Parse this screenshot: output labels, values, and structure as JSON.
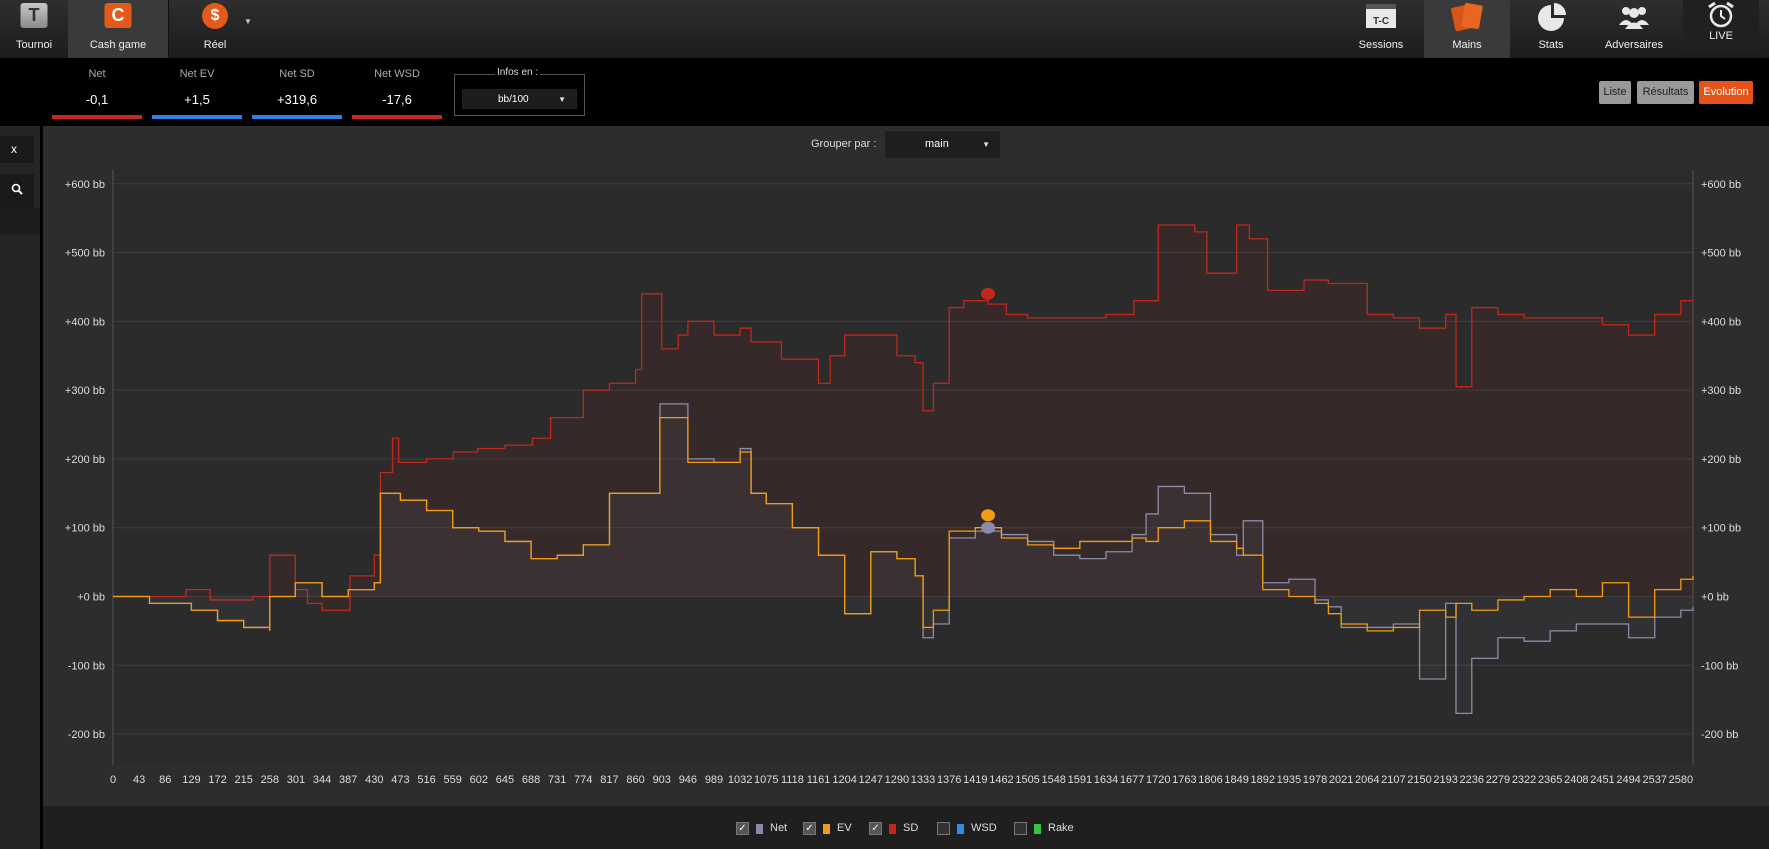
{
  "nav": {
    "left": [
      {
        "label": "Tournoi",
        "tile": "T"
      },
      {
        "label": "Cash game",
        "tile": "C"
      },
      {
        "label": "Réel",
        "tile": "$"
      }
    ],
    "right": [
      {
        "label": "Sessions",
        "tile": "T-C"
      },
      {
        "label": "Mains"
      },
      {
        "label": "Stats"
      },
      {
        "label": "Adversaires"
      },
      {
        "label": "LIVE"
      }
    ],
    "active_left": "Cash game",
    "active_right": "Mains"
  },
  "stats": [
    {
      "label": "Net",
      "value": "-0,1",
      "color": "#c8281e"
    },
    {
      "label": "Net EV",
      "value": "+1,5",
      "color": "#2f7fe6"
    },
    {
      "label": "Net SD",
      "value": "+319,6",
      "color": "#2f7fe6"
    },
    {
      "label": "Net WSD",
      "value": "-17,6",
      "color": "#c8281e"
    }
  ],
  "infos": {
    "title": "Infos en :",
    "selected": "bb/100"
  },
  "view_buttons": [
    {
      "label": "Liste",
      "active": false
    },
    {
      "label": "Résultats",
      "active": false
    },
    {
      "label": "Evolution",
      "active": true
    }
  ],
  "sidebar": {
    "close_label": "x",
    "zoom_icon": "magnifier-icon"
  },
  "group": {
    "label": "Grouper par :",
    "selected": "main"
  },
  "legend": [
    {
      "label": "Net",
      "checked": true,
      "color": "#8888aa"
    },
    {
      "label": "EV",
      "checked": true,
      "color": "#f39c12"
    },
    {
      "label": "SD",
      "checked": true,
      "color": "#c0281c"
    },
    {
      "label": "WSD",
      "checked": false,
      "color": "#2f8ae8"
    },
    {
      "label": "Rake",
      "checked": false,
      "color": "#35c43d"
    }
  ],
  "chart_data": {
    "type": "line",
    "x_ticks": [
      0,
      43,
      86,
      129,
      172,
      215,
      258,
      301,
      344,
      387,
      430,
      473,
      516,
      559,
      602,
      645,
      688,
      731,
      774,
      817,
      860,
      903,
      946,
      989,
      1032,
      1075,
      1118,
      1161,
      1204,
      1247,
      1290,
      1333,
      1376,
      1419,
      1462,
      1505,
      1548,
      1591,
      1634,
      1677,
      1720,
      1763,
      1806,
      1849,
      1892,
      1935,
      1978,
      2021,
      2064,
      2107,
      2150,
      2193,
      2236,
      2279,
      2322,
      2365,
      2408,
      2451,
      2494,
      2537,
      2580
    ],
    "y_tick_labels": [
      "+600 bb",
      "+500 bb",
      "+400 bb",
      "+300 bb",
      "+200 bb",
      "+100 bb",
      "+0 bb",
      "-100 bb",
      "-200 bb"
    ],
    "y_ticks": [
      600,
      500,
      400,
      300,
      200,
      100,
      0,
      -100,
      -200
    ],
    "xlim": [
      0,
      2600
    ],
    "ylim": [
      -245,
      620
    ],
    "grid": true,
    "series": [
      {
        "name": "SD",
        "color": "#c0281c",
        "fill": true,
        "x": [
          0,
          120,
          160,
          230,
          258,
          258,
          300,
          320,
          344,
          390,
          430,
          440,
          460,
          470,
          516,
          560,
          600,
          645,
          690,
          720,
          774,
          817,
          860,
          870,
          903,
          930,
          946,
          989,
          1032,
          1050,
          1100,
          1161,
          1180,
          1204,
          1250,
          1290,
          1320,
          1333,
          1350,
          1376,
          1400,
          1440,
          1470,
          1505,
          1560,
          1634,
          1680,
          1720,
          1780,
          1800,
          1849,
          1870,
          1900,
          1960,
          2000,
          2064,
          2107,
          2150,
          2193,
          2210,
          2236,
          2279,
          2322,
          2400,
          2451,
          2494,
          2537,
          2580,
          2600
        ],
        "y": [
          0,
          10,
          -5,
          0,
          35,
          60,
          10,
          -10,
          -20,
          30,
          60,
          180,
          230,
          195,
          200,
          210,
          215,
          220,
          230,
          260,
          300,
          310,
          330,
          440,
          360,
          380,
          400,
          380,
          390,
          370,
          345,
          310,
          350,
          380,
          380,
          350,
          340,
          270,
          310,
          420,
          430,
          425,
          410,
          405,
          405,
          410,
          430,
          540,
          530,
          470,
          540,
          520,
          445,
          460,
          455,
          410,
          405,
          390,
          410,
          305,
          420,
          410,
          405,
          405,
          395,
          380,
          410,
          430,
          430
        ]
      },
      {
        "name": "Net",
        "color": "#8c8ca8",
        "fill": true,
        "x": [
          0,
          60,
          129,
          172,
          215,
          258,
          258,
          300,
          344,
          387,
          430,
          440,
          473,
          516,
          559,
          602,
          645,
          688,
          731,
          774,
          817,
          860,
          875,
          900,
          946,
          989,
          1032,
          1050,
          1075,
          1118,
          1161,
          1204,
          1247,
          1290,
          1320,
          1333,
          1350,
          1376,
          1419,
          1462,
          1505,
          1548,
          1591,
          1634,
          1677,
          1700,
          1720,
          1763,
          1806,
          1849,
          1860,
          1892,
          1935,
          1978,
          2000,
          2021,
          2064,
          2107,
          2150,
          2193,
          2210,
          2236,
          2279,
          2322,
          2365,
          2408,
          2451,
          2494,
          2537,
          2580,
          2600
        ],
        "y": [
          0,
          -10,
          -20,
          -35,
          -45,
          -50,
          0,
          20,
          0,
          10,
          20,
          150,
          140,
          125,
          100,
          95,
          80,
          55,
          60,
          75,
          150,
          150,
          150,
          280,
          200,
          195,
          215,
          150,
          135,
          100,
          60,
          -25,
          65,
          55,
          30,
          -60,
          -40,
          85,
          95,
          90,
          80,
          60,
          55,
          65,
          90,
          120,
          160,
          150,
          90,
          60,
          110,
          20,
          25,
          -5,
          -15,
          -45,
          -45,
          -40,
          -120,
          -10,
          -170,
          -90,
          -60,
          -65,
          -50,
          -40,
          -40,
          -60,
          -30,
          -20,
          -15
        ]
      },
      {
        "name": "EV",
        "color": "#f39c12",
        "fill": false,
        "x": [
          0,
          60,
          129,
          172,
          215,
          258,
          258,
          300,
          344,
          387,
          430,
          440,
          473,
          516,
          559,
          602,
          645,
          688,
          731,
          774,
          817,
          860,
          875,
          900,
          946,
          989,
          1032,
          1050,
          1075,
          1118,
          1161,
          1204,
          1247,
          1290,
          1320,
          1333,
          1350,
          1376,
          1419,
          1462,
          1505,
          1548,
          1591,
          1634,
          1677,
          1700,
          1720,
          1763,
          1806,
          1849,
          1860,
          1892,
          1935,
          1978,
          2000,
          2021,
          2064,
          2107,
          2150,
          2193,
          2210,
          2236,
          2279,
          2322,
          2365,
          2408,
          2451,
          2494,
          2537,
          2580,
          2600
        ],
        "y": [
          0,
          -10,
          -20,
          -35,
          -45,
          -50,
          0,
          20,
          0,
          10,
          20,
          150,
          140,
          125,
          100,
          95,
          80,
          55,
          60,
          75,
          150,
          150,
          150,
          260,
          195,
          195,
          210,
          150,
          135,
          100,
          60,
          -25,
          65,
          55,
          30,
          -45,
          -20,
          95,
          100,
          85,
          75,
          70,
          80,
          80,
          85,
          80,
          100,
          110,
          80,
          70,
          60,
          10,
          0,
          -10,
          -25,
          -40,
          -50,
          -45,
          -20,
          -30,
          -10,
          -20,
          -5,
          0,
          10,
          0,
          20,
          -30,
          10,
          25,
          30
        ]
      }
    ],
    "markers": [
      {
        "series": "SD",
        "x": 1440,
        "y": 440
      },
      {
        "series": "EV",
        "x": 1440,
        "y": 118
      },
      {
        "series": "Net",
        "x": 1440,
        "y": 100
      }
    ]
  }
}
